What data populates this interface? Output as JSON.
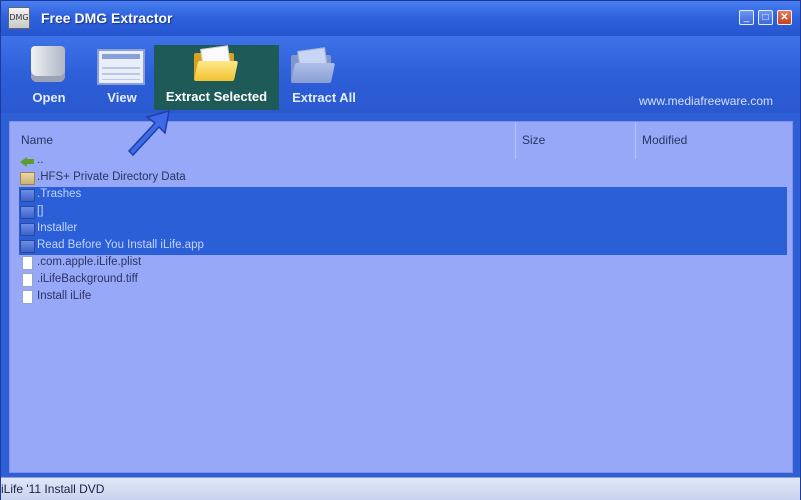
{
  "window": {
    "title": "Free DMG Extractor",
    "app_icon_text": "DMG",
    "controls": {
      "minimize": "_",
      "maximize": "□",
      "close": "✕"
    }
  },
  "toolbar": {
    "buttons": [
      {
        "label": "Open",
        "icon": "drive-icon"
      },
      {
        "label": "View",
        "icon": "window-list-icon"
      },
      {
        "label": "Extract Selected",
        "icon": "open-folder-icon",
        "active": true
      },
      {
        "label": "Extract All",
        "icon": "folder-icon"
      }
    ],
    "website": "www.mediafreeware.com"
  },
  "file_list": {
    "columns": [
      "Name",
      "Size",
      "Modified"
    ],
    "rows": [
      {
        "name": "..",
        "icon": "up-arrow-icon",
        "selected": false
      },
      {
        "name": ".HFS+ Private Directory Data",
        "icon": "folder-open-icon",
        "selected": false
      },
      {
        "name": ".Trashes",
        "icon": "folder-icon",
        "selected": true
      },
      {
        "name": "[]",
        "icon": "folder-icon",
        "selected": true
      },
      {
        "name": "Installer",
        "icon": "folder-icon",
        "selected": true
      },
      {
        "name": "Read Before You Install iLife.app",
        "icon": "folder-icon",
        "selected": true
      },
      {
        "name": ".com.apple.iLife.plist",
        "icon": "file-icon",
        "selected": false
      },
      {
        "name": ".iLifeBackground.tiff",
        "icon": "file-icon",
        "selected": false
      },
      {
        "name": "Install iLife",
        "icon": "file-icon",
        "selected": false
      }
    ]
  },
  "status_bar": {
    "text": "iLife '11 Install DVD"
  },
  "colors": {
    "title_bar": "#2f62de",
    "selection": "#2a5fd8",
    "list_bg": "#96a8f7",
    "active_button": "#1e5a58"
  }
}
